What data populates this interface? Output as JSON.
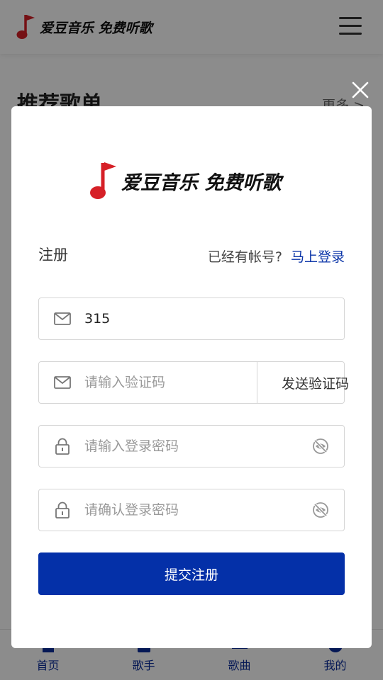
{
  "header": {
    "brand": "爱豆音乐 免费听歌",
    "menu_icon": "hamburger-icon"
  },
  "section": {
    "title": "推荐歌单",
    "more": "更多 >"
  },
  "bottom_nav": [
    {
      "label": "首页",
      "icon": "home-icon"
    },
    {
      "label": "歌手",
      "icon": "singer-icon"
    },
    {
      "label": "歌曲",
      "icon": "song-list-icon"
    },
    {
      "label": "我的",
      "icon": "profile-icon"
    }
  ],
  "modal": {
    "brand": "爱豆音乐 免费听歌",
    "title": "注册",
    "have_account": "已经有帐号?",
    "login_link": "马上登录",
    "email": {
      "value": "315",
      "icon": "mail-icon"
    },
    "code": {
      "placeholder": "请输入验证码",
      "send_label": "发送验证码",
      "icon": "mail-icon"
    },
    "password": {
      "placeholder": "请输入登录密码",
      "icon": "lock-icon",
      "toggle_icon": "eye-off-icon"
    },
    "confirm": {
      "placeholder": "请确认登录密码",
      "icon": "lock-icon",
      "toggle_icon": "eye-off-icon"
    },
    "submit": "提交注册",
    "close_icon": "close-icon"
  },
  "colors": {
    "brand_red": "#d62027",
    "primary_blue": "#0430a8",
    "link_blue": "#0b35a8",
    "nav_blue": "#0a2c9b"
  }
}
